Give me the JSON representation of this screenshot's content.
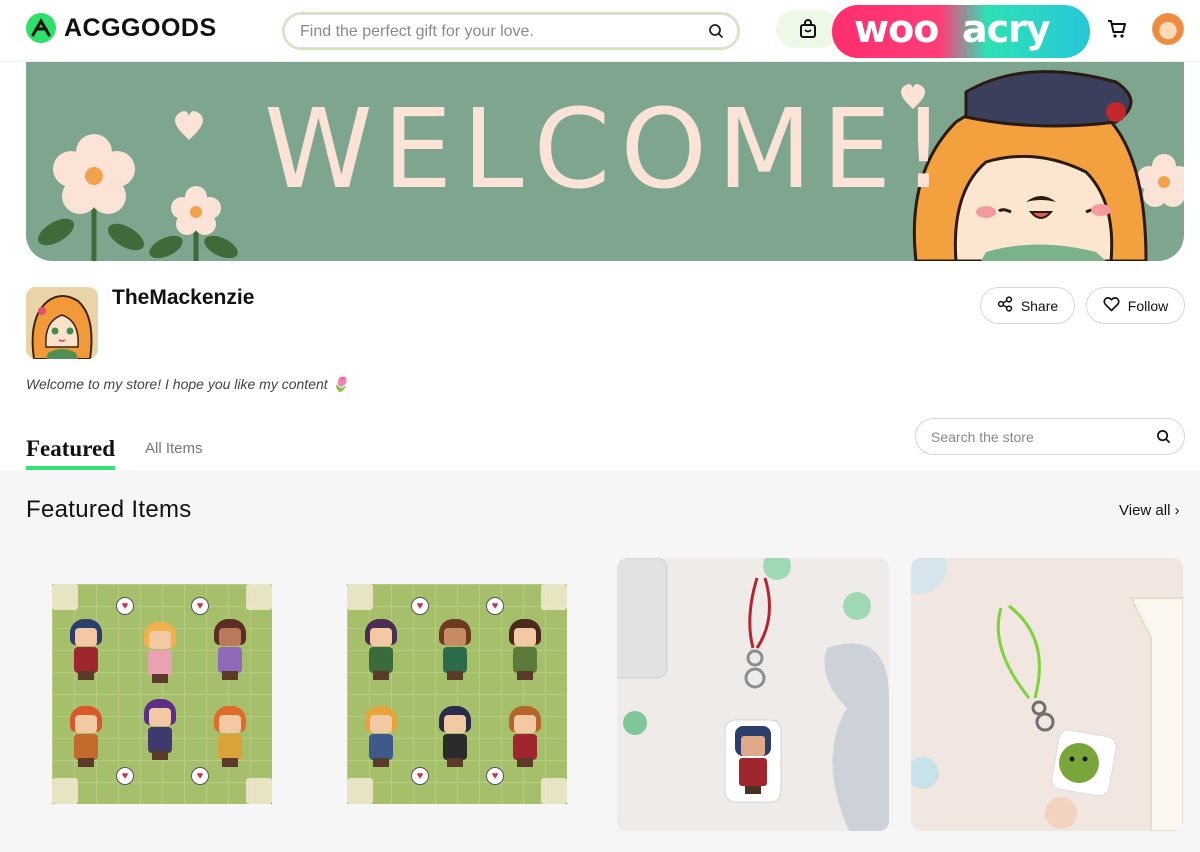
{
  "header": {
    "logo_text": "ACGGOODS",
    "search_placeholder": "Find the perfect gift for your love.",
    "promo_text_left": "woo",
    "promo_text_right": "acry"
  },
  "banner": {
    "title": "WELCOME!"
  },
  "store": {
    "name": "TheMackenzie",
    "description": "Welcome to my store! I hope you like my content 🌷",
    "share_label": "Share",
    "follow_label": "Follow"
  },
  "tabs": [
    {
      "label": "Featured",
      "active": true
    },
    {
      "label": "All Items",
      "active": false
    }
  ],
  "store_search": {
    "placeholder": "Search the store"
  },
  "featured": {
    "title": "Featured Items",
    "view_all_label": "View all ›"
  },
  "colors": {
    "brand_green": "#2fe06b",
    "banner_bg": "#7ea58e",
    "tab_underline": "#35e27a"
  }
}
